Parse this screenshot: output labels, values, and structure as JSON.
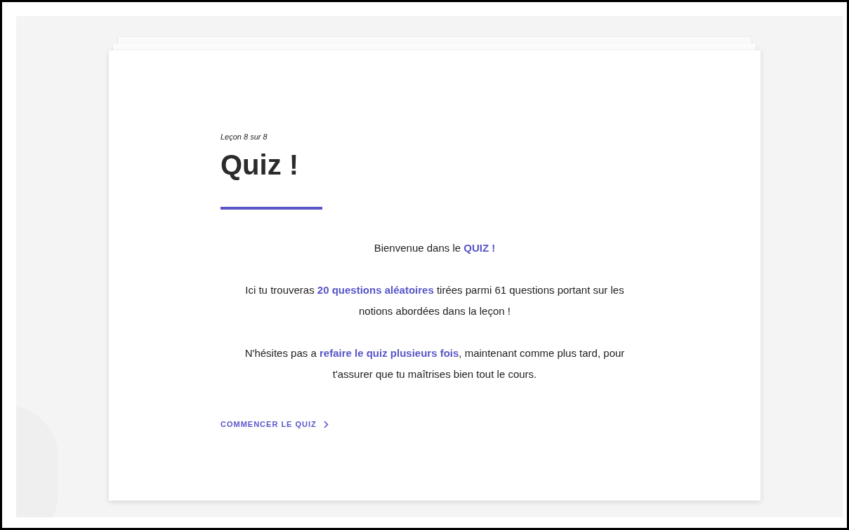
{
  "lesson": {
    "progress": "Leçon 8 sur 8",
    "title": "Quiz !"
  },
  "paragraphs": [
    "Bienvenue dans le **QUIZ !**",
    "Ici tu trouveras **20 questions aléatoires** tirées parmi 61 questions portant sur les notions abordées dans la leçon !",
    "N'hésites pas a **refaire le quiz plusieurs fois**, maintenant comme plus tard, pour t'assurer que tu maîtrises bien tout le cours."
  ],
  "start_button": {
    "label": "COMMENCER LE QUIZ"
  }
}
